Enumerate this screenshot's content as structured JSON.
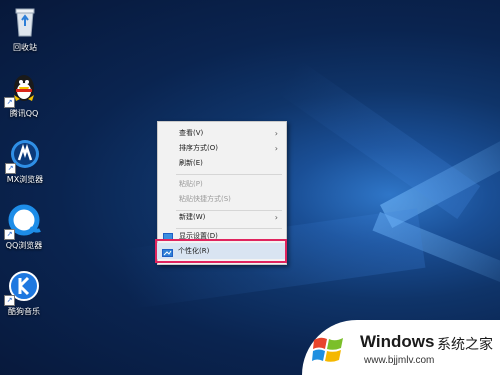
{
  "desktop": {
    "icons": [
      {
        "label": "回收站",
        "icon": "recycle-bin-icon"
      },
      {
        "label": "腾讯QQ",
        "icon": "qq-penguin-icon"
      },
      {
        "label": "MX浏览器",
        "icon": "maxthon-browser-icon"
      },
      {
        "label": "QQ浏览器",
        "icon": "qq-browser-icon"
      },
      {
        "label": "酷狗音乐",
        "icon": "kugou-music-icon"
      }
    ]
  },
  "context_menu": {
    "items": [
      {
        "label": "查看(V)",
        "submenu": true,
        "enabled": true
      },
      {
        "label": "排序方式(O)",
        "submenu": true,
        "enabled": true
      },
      {
        "label": "刷新(E)",
        "submenu": false,
        "enabled": true
      },
      {
        "label": "粘贴(P)",
        "submenu": false,
        "enabled": false
      },
      {
        "label": "粘贴快捷方式(S)",
        "submenu": false,
        "enabled": false
      },
      {
        "label": "新建(W)",
        "submenu": true,
        "enabled": true
      },
      {
        "label": "显示设置(D)",
        "icon": "display-settings-icon",
        "enabled": true
      },
      {
        "label": "个性化(R)",
        "icon": "personalize-icon",
        "enabled": true,
        "highlighted": true
      }
    ],
    "highlight_color": "#e0245e"
  },
  "watermark": {
    "brand": "Windows",
    "suffix": "系统之家",
    "url": "www.bjjmlv.com"
  },
  "colors": {
    "accent_blue": "#1f5fc5",
    "highlight_red": "#e0245e"
  }
}
